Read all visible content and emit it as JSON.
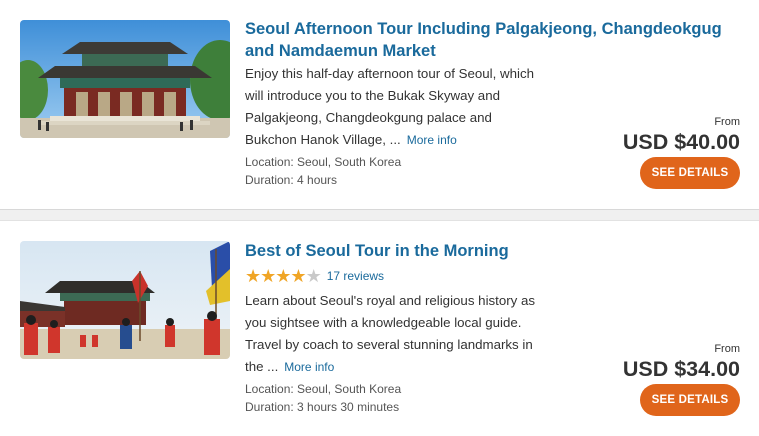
{
  "tours": [
    {
      "title": "Seoul Afternoon Tour Including Palgakjeong, Changdeokgug and Namdaemun Market",
      "description": "Enjoy this half-day afternoon tour of Seoul, which will introduce you to the Bukak Skyway and Palgakjeong, Changdeokgung palace and Bukchon Hanok Village, ...",
      "more_info": "More info",
      "location": "Location: Seoul, South Korea",
      "duration": "Duration: 4 hours",
      "from_label": "From",
      "price": "USD $40.00",
      "button_label": "SEE DETAILS",
      "image_icon": "palace-photo"
    },
    {
      "title": "Best of Seoul Tour in the Morning",
      "rating": 4,
      "rating_max": 5,
      "reviews": "17 reviews",
      "description": "Learn about Seoul's royal and religious history as you sightsee with a knowledgeable local guide. Travel by coach to several stunning landmarks in the ...",
      "more_info": "More info",
      "location": "Location: Seoul, South Korea",
      "duration": "Duration: 3 hours 30 minutes",
      "from_label": "From",
      "price": "USD $34.00",
      "button_label": "SEE DETAILS",
      "image_icon": "guard-ceremony-photo"
    }
  ],
  "colors": {
    "link": "#1a6a9c",
    "button": "#e0651b",
    "star": "#f0a526",
    "star_empty": "#c9c9c9"
  }
}
